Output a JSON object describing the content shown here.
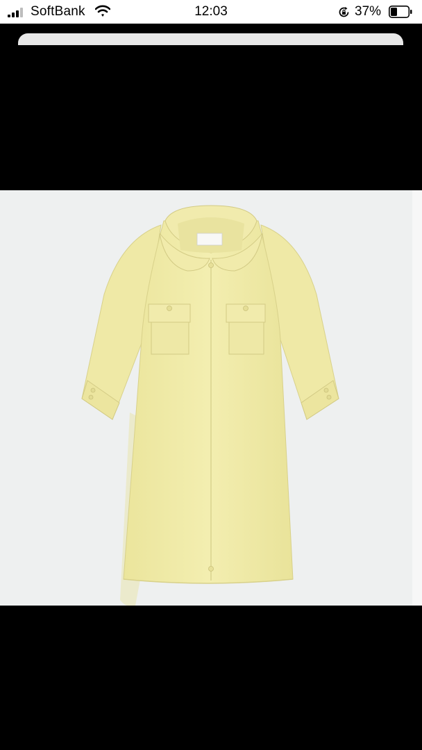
{
  "status_bar": {
    "carrier": "SoftBank",
    "time": "12:03",
    "battery_percent": "37%",
    "signal_icon": "signal-bars-icon",
    "wifi_icon": "wifi-icon",
    "orientation_lock_icon": "orientation-lock-icon",
    "battery_icon": "battery-icon",
    "battery_level": 0.37
  },
  "product_image": {
    "subject": "yellow-coat",
    "colors": {
      "coat": "#f1ecaa",
      "background": "#eef0f0"
    }
  }
}
